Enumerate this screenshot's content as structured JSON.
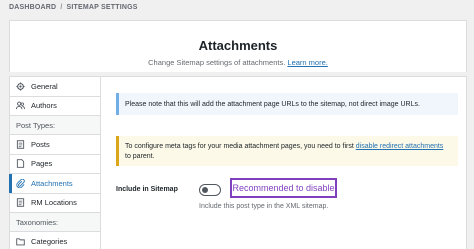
{
  "breadcrumb": {
    "items": [
      "DASHBOARD",
      "SITEMAP SETTINGS"
    ],
    "separator": "/"
  },
  "header": {
    "title": "Attachments",
    "subtitle": "Change Sitemap settings of attachments.",
    "learn_more": "Learn more."
  },
  "sidebar": {
    "general": "General",
    "authors": "Authors",
    "post_types_heading": "Post Types:",
    "posts": "Posts",
    "pages": "Pages",
    "attachments": "Attachments",
    "rm_locations": "RM Locations",
    "taxonomies_heading": "Taxonomies:",
    "categories": "Categories"
  },
  "notices": {
    "info": "Please note that this will add the attachment page URLs to the sitemap, not direct image URLs.",
    "warning_prefix": "To configure meta tags for your media attachment pages, you need to first ",
    "warning_link": "disable redirect attachments",
    "warning_suffix": " to parent."
  },
  "setting": {
    "label": "Include in Sitemap",
    "toggle_on": false,
    "recommendation": "Recommended to disable",
    "description": "Include this post type in the XML sitemap."
  },
  "colors": {
    "accent": "#2271b1",
    "highlight": "#7f3fbf",
    "info_border": "#72aee6",
    "warning_border": "#dba617"
  }
}
